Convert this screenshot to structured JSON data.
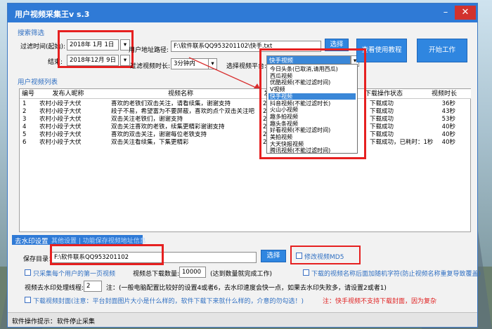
{
  "window": {
    "title": "用户视频采集王v s.3"
  },
  "search_group": {
    "title": "搜索筛选",
    "date_start_label": "过滤时间(起始):",
    "date_start_value": "2018年 1月 1日",
    "date_end_label": "结束:",
    "date_end_value": "2018年12月 9日",
    "user_path_label": "用户地址路径:",
    "user_path_value": "F:\\软件联系QQ953201102\\快手.txt",
    "browse_label": "选择",
    "duration_label": "过滤视频时长:",
    "duration_value": "3分钟内",
    "platform_label": "选择视频平台:",
    "platform_value": "快手视频",
    "help_button": "查看使用教程",
    "start_button": "开始工作"
  },
  "platform_options": [
    "今日头条(已取消,请用西瓜)",
    "西瓜视频",
    "优酷视频(不能过滤时间)",
    "V视频",
    "快手视频",
    "抖音视频(不能过滤时长)",
    "火山小视频",
    "趣多拍视频",
    "趣头条视频",
    "好看视频(不能过滤时间)",
    "美拍视频",
    "大天快报视频",
    "腾讯视频(不能过滤时间)",
    "秒拍视频"
  ],
  "selected_option_index": 4,
  "video_list": {
    "title": "用户视频列表",
    "columns": [
      "编号",
      "发布人昵称",
      "视频名称",
      "发",
      "下载操作状态",
      "视频时长"
    ],
    "rows": [
      {
        "id": "1",
        "author": "农村小段子大伏",
        "name": "喜欢的老铁们双击关注，请看续集，谢谢支持",
        "date": "201",
        "status": "下载成功",
        "duration": "36秒"
      },
      {
        "id": "2",
        "author": "农村小段子大伏",
        "name": "段子不易，希望富为不要屏蔽，喜欢的点个双击关注吧",
        "date": "201",
        "status": "下载成功",
        "duration": "43秒"
      },
      {
        "id": "3",
        "author": "农村小段子大伏",
        "name": "双击关注老铁们，谢谢支持",
        "date": "201",
        "status": "下载成功",
        "duration": "53秒"
      },
      {
        "id": "4",
        "author": "农村小段子大伏",
        "name": "双击关注喜欢的老铁，续集更精彩谢谢支持",
        "date": "201",
        "status": "下载成功",
        "duration": "40秒"
      },
      {
        "id": "5",
        "author": "农村小段子大伏",
        "name": "喜欢的双击关注，谢谢每位老铁支持",
        "date": "201",
        "status": "下载成功",
        "duration": "40秒"
      },
      {
        "id": "6",
        "author": "农村小段子大伏",
        "name": "双击关注看续集，下集更精彩",
        "date": "201",
        "status": "下载成功，已耗时：1秒",
        "duration": "40秒"
      }
    ]
  },
  "watermark_group": {
    "title": "去水印设置",
    "tab_other": "其他设置 | 功能保存视频地址信息",
    "save_dir_label": "保存目录：",
    "save_dir_value": "F:\\软件联系QQ953201102",
    "browse_label": "选择",
    "md5_label": "修改视频MD5",
    "only_first_page_label": "只采集每个用户的第一页视频",
    "total_label": "视频总下载数量:",
    "total_value": "10000",
    "total_note": "(达到数量就完成工作)",
    "random_suffix_label": "下载的视频名称后面加随机字符(防止视频名称重复导致覆盖)",
    "threads_label": "视频去水印处理线程:",
    "threads_value": "2",
    "threads_note": "注：(一般电脑配置比较好的设置4或者6，去水印速度会快一点，如果去水印失败多，请设置2或者1)",
    "cover_label": "下载视频封面(注意：平台封面图片大小是什么样的，软件下载下来就什么样的，介意的勿勾选！)",
    "cover_warning": "注：快手视频不支持下载封面，因为复杂"
  },
  "status_bar": {
    "label": "软件操作提示：",
    "value": "软件停止采集"
  }
}
